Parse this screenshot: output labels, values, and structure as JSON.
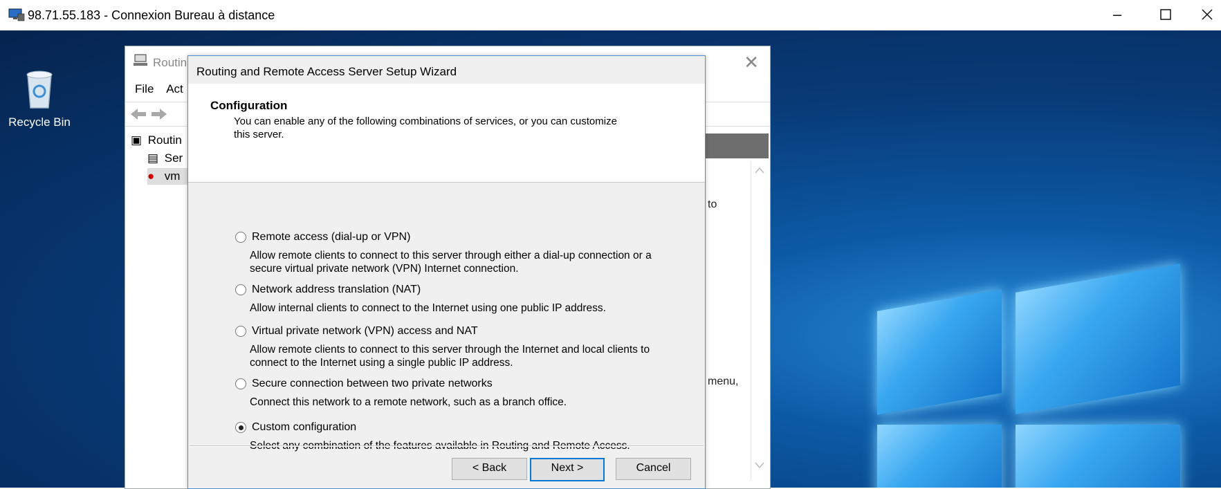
{
  "rdp": {
    "title": "98.71.55.183 - Connexion Bureau à distance",
    "icon": "remote-desktop-icon"
  },
  "desktop": {
    "recycle_bin_label": "Recycle Bin"
  },
  "mmc": {
    "title": "Routin",
    "menu": [
      "File",
      "Act"
    ],
    "tree": [
      "Routin",
      "Ser",
      "vm"
    ],
    "right_text": [
      "to",
      "menu,"
    ]
  },
  "wizard": {
    "title": "Routing and Remote Access Server Setup Wizard",
    "header_title": "Configuration",
    "header_subtitle": "You can enable any of the following combinations of services, or you can customize this server.",
    "options": [
      {
        "label": "Remote access (dial-up or VPN)",
        "desc": "Allow remote clients to connect to this server through either a dial-up connection or a secure virtual private network (VPN) Internet connection.",
        "selected": false
      },
      {
        "label": "Network address translation (NAT)",
        "desc": "Allow internal clients to connect to the Internet using one public IP address.",
        "selected": false
      },
      {
        "label": "Virtual private network (VPN) access and NAT",
        "desc": "Allow remote clients to connect to this server through the Internet and local clients to connect to the Internet using a single public IP address.",
        "selected": false
      },
      {
        "label": "Secure connection between two private networks",
        "desc": "Connect this network to a remote network, such as a branch office.",
        "selected": false
      },
      {
        "label": "Custom configuration",
        "desc": "Select any combination of the features available in Routing and Remote Access.",
        "selected": true
      }
    ],
    "buttons": {
      "back": "< Back",
      "next": "Next >",
      "cancel": "Cancel"
    }
  },
  "colors": {
    "accent": "#0078d7",
    "desktop": "#0c5aa6"
  }
}
